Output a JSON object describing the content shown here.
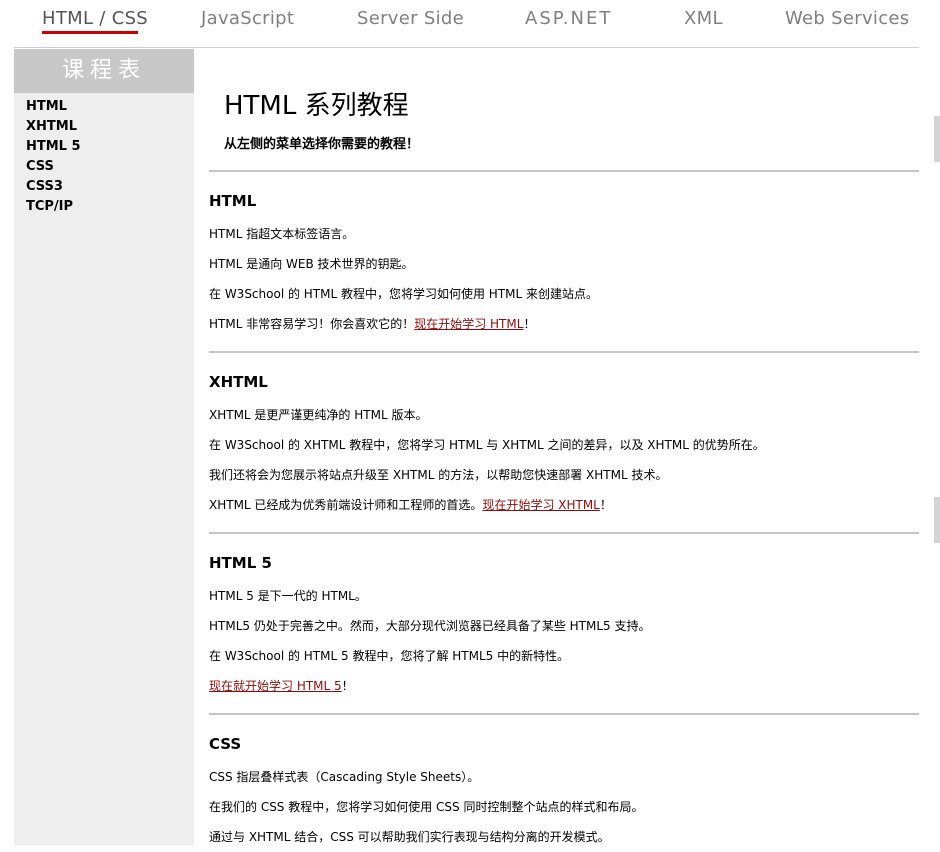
{
  "nav": {
    "items": [
      "HTML / CSS",
      "JavaScript",
      "Server Side",
      "ASP.NET",
      "XML",
      "Web Services"
    ],
    "active_index": 0
  },
  "sidebar": {
    "heading": "课程表",
    "items": [
      "HTML",
      "XHTML",
      "HTML 5",
      "CSS",
      "CSS3",
      "TCP/IP"
    ]
  },
  "main": {
    "title": "HTML 系列教程",
    "intro": "从左侧的菜单选择你需要的教程！",
    "sections": [
      {
        "heading": "HTML",
        "lines": [
          "HTML 指超文本标签语言。",
          "HTML 是通向 WEB 技术世界的钥匙。",
          "在 W3School 的 HTML 教程中，您将学习如何使用 HTML 来创建站点。"
        ],
        "link_prefix": "HTML 非常容易学习！你会喜欢它的！",
        "link_text": "现在开始学习 HTML",
        "link_suffix": "！"
      },
      {
        "heading": "XHTML",
        "lines": [
          "XHTML 是更严谨更纯净的 HTML 版本。",
          "在 W3School 的 XHTML 教程中，您将学习 HTML 与 XHTML 之间的差异，以及 XHTML 的优势所在。",
          "我们还将会为您展示将站点升级至 XHTML 的方法，以帮助您快速部署 XHTML 技术。"
        ],
        "link_prefix": "XHTML 已经成为优秀前端设计师和工程师的首选。",
        "link_text": "现在开始学习 XHTML",
        "link_suffix": "！"
      },
      {
        "heading": "HTML 5",
        "lines": [
          "HTML 5 是下一代的 HTML。",
          "HTML5 仍处于完善之中。然而，大部分现代浏览器已经具备了某些 HTML5 支持。",
          "在 W3School 的 HTML 5 教程中，您将了解 HTML5 中的新特性。"
        ],
        "link_prefix": "",
        "link_text": "现在就开始学习 HTML 5",
        "link_suffix": "！"
      },
      {
        "heading": "CSS",
        "lines": [
          "CSS 指层叠样式表（Cascading Style Sheets）。",
          "在我们的 CSS 教程中，您将学习如何使用 CSS 同时控制整个站点的样式和布局。",
          "通过与 XHTML 结合，CSS 可以帮助我们实行表现与结构分离的开发模式。"
        ]
      }
    ]
  },
  "colors": {
    "link": "#900b09",
    "nav_underline": "#cc0000",
    "sidebar_bg": "#eeeeee",
    "sidebar_head_bg": "#c8c8c8"
  }
}
